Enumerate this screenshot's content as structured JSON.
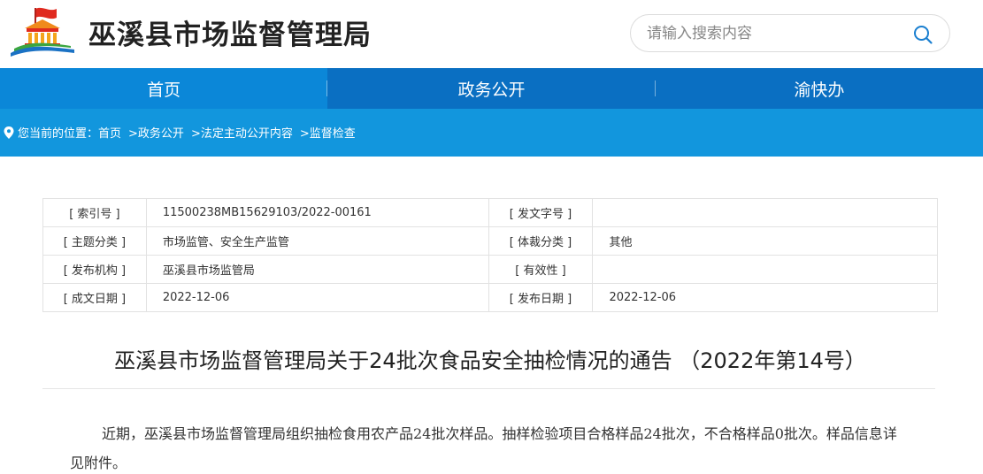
{
  "header": {
    "site_title": "巫溪县市场监督管理局",
    "search_placeholder": "请输入搜索内容",
    "logo_icon": "government-building-emblem-icon"
  },
  "nav": {
    "items": [
      "首页",
      "政务公开",
      "渝快办"
    ],
    "active_index": 0
  },
  "breadcrumb": {
    "prefix": "您当前的位置：",
    "items": [
      "首页",
      ">政务公开",
      ">法定主动公开内容",
      ">监督检查"
    ]
  },
  "info_table": {
    "rows": [
      {
        "label1": "[ 索引号 ]",
        "value1": "11500238MB15629103/2022-00161",
        "label2": "[ 发文字号 ]",
        "value2": ""
      },
      {
        "label1": "[ 主题分类 ]",
        "value1": "市场监管、安全生产监管",
        "label2": "[ 体裁分类 ]",
        "value2": "其他"
      },
      {
        "label1": "[ 发布机构 ]",
        "value1": "巫溪县市场监管局",
        "label2": "[ 有效性 ]",
        "value2": ""
      },
      {
        "label1": "[ 成文日期 ]",
        "value1": "2022-12-06",
        "label2": "[ 发布日期 ]",
        "value2": "2022-12-06"
      }
    ]
  },
  "article": {
    "title": "巫溪县市场监督管理局关于24批次食品安全抽检情况的通告 （2022年第14号）",
    "body": "近期，巫溪县市场监督管理局组织抽检食用农产品24批次样品。抽样检验项目合格样品24批次，不合格样品0批次。样品信息详见附件。"
  },
  "colors": {
    "nav_bg": "#0a6fc2",
    "nav_active": "#0b87d8",
    "breadcrumb_bg": "#1296dd"
  }
}
